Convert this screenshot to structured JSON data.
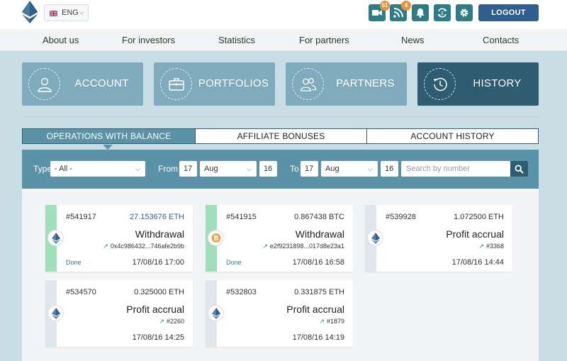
{
  "header": {
    "language": "ENG",
    "notifications": [
      {
        "icon": "video-icon",
        "count": "51"
      },
      {
        "icon": "rss-icon",
        "count": "4"
      },
      {
        "icon": "bell-icon",
        "count": ""
      },
      {
        "icon": "exchange-icon",
        "count": ""
      },
      {
        "icon": "gear-icon",
        "count": ""
      }
    ],
    "logout_label": "LOGOUT"
  },
  "nav": {
    "items": [
      "About us",
      "For investors",
      "Statistics",
      "For partners",
      "News",
      "Contacts"
    ]
  },
  "tiles": [
    {
      "label": "ACCOUNT",
      "icon": "user-icon",
      "active": false
    },
    {
      "label": "PORTFOLIOS",
      "icon": "briefcase-icon",
      "active": false
    },
    {
      "label": "PARTNERS",
      "icon": "users-icon",
      "active": false
    },
    {
      "label": "HISTORY",
      "icon": "history-icon",
      "active": true
    }
  ],
  "tabs": [
    "OPERATIONS WITH BALANCE",
    "AFFILIATE BONUSES",
    "ACCOUNT HISTORY"
  ],
  "filter": {
    "type_label": "Type",
    "type_value": "- All -",
    "from_label": "From",
    "from_day": "17",
    "from_month": "Aug",
    "from_year": "16",
    "to_label": "To",
    "to_day": "17",
    "to_month": "Aug",
    "to_year": "16",
    "search_placeholder": "Search by number"
  },
  "operations": [
    {
      "id": "#541917",
      "amount": "27.153676 ETH",
      "type": "Withdrawal",
      "ref": "0x4c986432...746afe2b9b",
      "status": "Done",
      "date": "17/08/16 17:00",
      "coin": "eth"
    },
    {
      "id": "#541915",
      "amount": "0.867438 BTC",
      "type": "Withdrawal",
      "ref": "e2f9231898...017d8e23a1",
      "status": "Done",
      "date": "17/08/16 16:58",
      "coin": "btc"
    },
    {
      "id": "#539928",
      "amount": "1.072500 ETH",
      "type": "Profit accrual",
      "ref": "#3368",
      "status": "",
      "date": "17/08/16 14:44",
      "coin": "eth"
    },
    {
      "id": "#534570",
      "amount": "0.325000 ETH",
      "type": "Profit accrual",
      "ref": "#2260",
      "status": "",
      "date": "17/08/16 14:25",
      "coin": "eth"
    },
    {
      "id": "#532803",
      "amount": "0.331875 ETH",
      "type": "Profit accrual",
      "ref": "#1879",
      "status": "",
      "date": "17/08/16 14:19",
      "coin": "eth"
    }
  ],
  "colors": {
    "teal": "#2e7d85",
    "navy": "#2e5f8f",
    "tile": "#7fabbd",
    "tile_active": "#2e5d72",
    "done": "#9fdfb9",
    "badge": "#e8923a"
  }
}
